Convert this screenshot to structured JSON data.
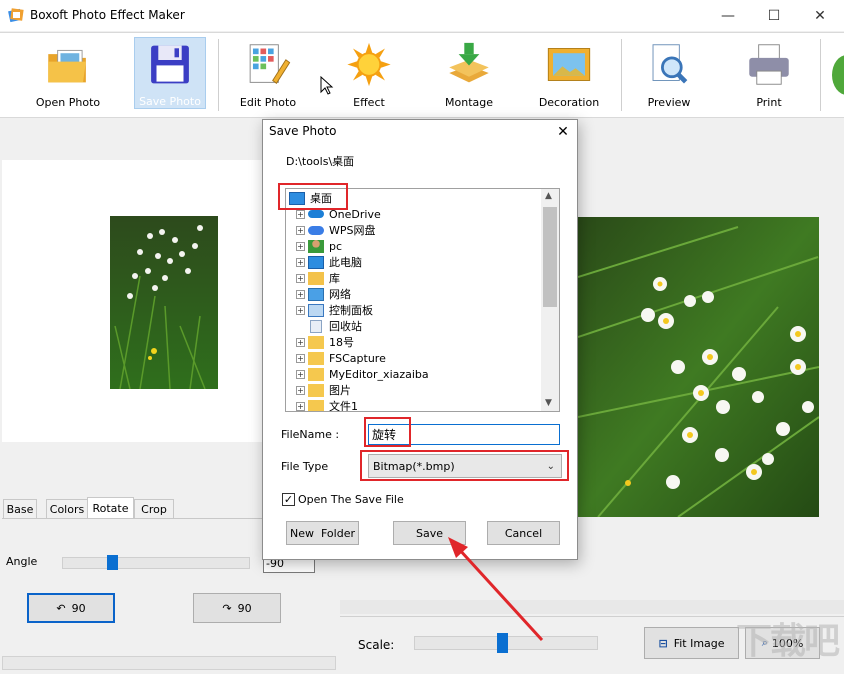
{
  "window": {
    "title": "Boxoft Photo Effect Maker",
    "controls": [
      "—",
      "☐",
      "✕"
    ]
  },
  "toolbar": {
    "items": [
      {
        "label": "Open Photo",
        "icon": "folder-photo-icon"
      },
      {
        "label": "Save Photo",
        "icon": "floppy-disk-icon",
        "active": true
      },
      {
        "label": "Edit Photo",
        "icon": "grid-pencil-icon"
      },
      {
        "label": "Effect",
        "icon": "sun-icon"
      },
      {
        "label": "Montage",
        "icon": "layers-download-icon"
      },
      {
        "label": "Decoration",
        "icon": "frame-landscape-icon"
      },
      {
        "label": "Preview",
        "icon": "magnifier-document-icon"
      },
      {
        "label": "Print",
        "icon": "printer-icon"
      }
    ]
  },
  "left": {
    "tabs": [
      "Base",
      "Colors",
      "Rotate",
      "Crop"
    ],
    "selected_tab": "Rotate",
    "angle_label": "Angle",
    "angle_value": "-90",
    "rotate_left_label": "90",
    "rotate_right_label": "90"
  },
  "bottom": {
    "scale_label": "Scale:",
    "fit_label": "Fit Image",
    "zoom_label": "100%"
  },
  "dialog": {
    "title": "Save Photo",
    "path": "D:\\tools\\桌面",
    "tree": [
      {
        "label": "桌面",
        "icon": "desktop-icon",
        "root": true
      },
      {
        "label": "OneDrive",
        "icon": "cloud-icon"
      },
      {
        "label": "WPS网盘",
        "icon": "cloud-icon"
      },
      {
        "label": "pc",
        "icon": "user-icon"
      },
      {
        "label": "此电脑",
        "icon": "computer-icon"
      },
      {
        "label": "库",
        "icon": "library-folder-icon"
      },
      {
        "label": "网络",
        "icon": "network-icon"
      },
      {
        "label": "控制面板",
        "icon": "control-panel-icon"
      },
      {
        "label": "回收站",
        "icon": "recycle-bin-icon",
        "no_expander": true
      },
      {
        "label": "18号",
        "icon": "folder-icon"
      },
      {
        "label": "FSCapture",
        "icon": "folder-icon"
      },
      {
        "label": "MyEditor_xiazaiba",
        "icon": "folder-icon"
      },
      {
        "label": "图片",
        "icon": "folder-icon"
      },
      {
        "label": "文件1",
        "icon": "folder-icon"
      }
    ],
    "filename_label": "FileName :",
    "filename_value": "旋转",
    "filetype_label": "File Type",
    "filetype_value": "Bitmap(*.bmp)",
    "open_after_save_label": "Open The Save File",
    "open_after_save_checked": true,
    "new_folder_label": "New  Folder",
    "save_label": "Save",
    "cancel_label": "Cancel"
  },
  "colors": {
    "accent": "#0a6fd1",
    "highlight_box": "#e0262a",
    "toolbar_active": "#cfe3f6"
  }
}
